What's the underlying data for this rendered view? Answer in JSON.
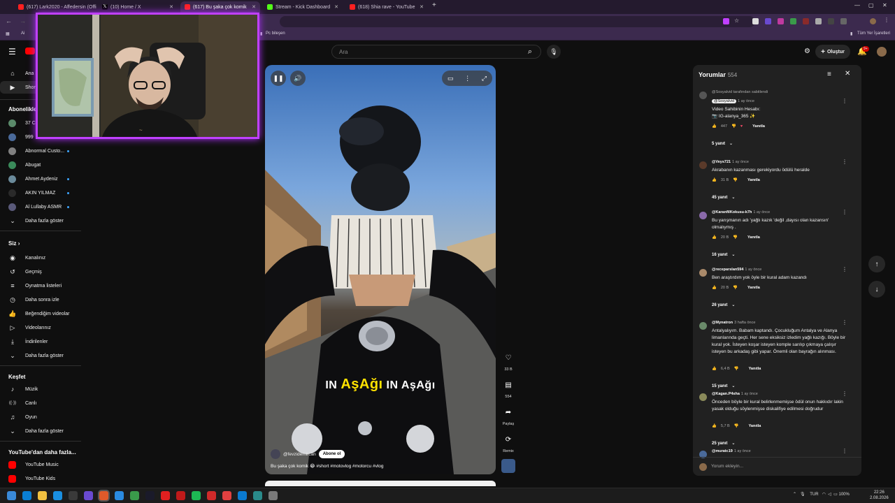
{
  "browser": {
    "tabs": [
      {
        "label": "(617) Lark2020 - Affedersin (Offi",
        "color": "#ff2020"
      },
      {
        "label": "(10) Home / X",
        "color": "#ffffff"
      },
      {
        "label": "(617) Bu şaka çok komik",
        "color": "#ff2020"
      },
      {
        "label": "Stream - Kick Dashboard",
        "color": "#53fc18"
      },
      {
        "label": "(618) Shia rave - YouTube",
        "color": "#ff2020"
      }
    ],
    "new_tab": "+",
    "bookmarks": {
      "pc": "Pc bileşen",
      "all": "Tüm Yer İşaretleri",
      "ai": "Ai"
    }
  },
  "header": {
    "logo_text": "YouTube",
    "search_placeholder": "Ara",
    "create_label": "Oluştur",
    "notif_badge": "9+"
  },
  "sidebar": {
    "main": [
      {
        "label": "Ana Sayfa",
        "icon": "home-icon"
      },
      {
        "label": "Shorts",
        "icon": "shorts-icon"
      }
    ],
    "subs_title": "Abonelikler",
    "subs": [
      {
        "label": "37 C",
        "color": "#5a8a6a",
        "dot": false
      },
      {
        "label": "999",
        "color": "#4a6a9a",
        "dot": false
      },
      {
        "label": "Abnormal Custo...",
        "color": "#808080",
        "dot": true
      },
      {
        "label": "Abugat",
        "color": "#3a8a5a",
        "dot": false
      },
      {
        "label": "Ahmet Aydeniz",
        "color": "#6a8a9a",
        "dot": true
      },
      {
        "label": "AKIN YILMAZ",
        "color": "#2a2a2a",
        "dot": true
      },
      {
        "label": "Al Lullaby ASMR",
        "color": "#5a5a7a",
        "dot": true
      }
    ],
    "show_more": "Daha fazla göster",
    "you_title": "Siz",
    "you": [
      {
        "label": "Kanalınız",
        "icon": "channel-icon"
      },
      {
        "label": "Geçmiş",
        "icon": "history-icon"
      },
      {
        "label": "Oynatma listeleri",
        "icon": "playlist-icon"
      },
      {
        "label": "Daha sonra izle",
        "icon": "clock-icon"
      },
      {
        "label": "Beğendiğim videolar",
        "icon": "like-icon"
      },
      {
        "label": "Videolarınız",
        "icon": "video-icon"
      },
      {
        "label": "İndirilenler",
        "icon": "download-icon"
      }
    ],
    "explore_title": "Keşfet",
    "explore": [
      {
        "label": "Müzik",
        "icon": "music-icon"
      },
      {
        "label": "Canlı",
        "icon": "live-icon"
      },
      {
        "label": "Oyun",
        "icon": "gaming-icon"
      }
    ],
    "more_yt_title": "YouTube'dan daha fazla...",
    "more_yt": [
      {
        "label": "YouTube Music",
        "color": "#ff0000"
      },
      {
        "label": "YouTube Kids",
        "color": "#ff0000"
      }
    ]
  },
  "video": {
    "caption_parts": [
      "IN ",
      "AşAğı",
      " IN AşAğı"
    ],
    "channel": "@fevzidemircan",
    "subscribe": "Abone ol",
    "description": "Bu şaka çok komik 😂 #short #motovlog #motorcu #vlog",
    "actions": {
      "likes": "33 B",
      "comments": "554",
      "share": "Paylaş",
      "remix": "Remix"
    }
  },
  "comments": {
    "title": "Yorumlar",
    "count": "554",
    "reply_label": "Yanıtla",
    "add_placeholder": "Yorum ekleyin...",
    "items": [
      {
        "pinned": "@Sosyalvid tarafından sabitlendi",
        "user": "@Sosyalvid",
        "time": "1 ay önce",
        "text": "Video Sahibinin Hesabı:\n📷 IG-alanya_365 ✨",
        "likes": "447",
        "replies": "5 yanıt",
        "color": "#555"
      },
      {
        "user": "@Veys721",
        "time": "1 ay önce",
        "text": "Akrabanın kazanması gerekiyordu ödülü heralde",
        "likes": "31 B",
        "replies": "45 yanıt",
        "color": "#5a3a2a"
      },
      {
        "user": "@KaranfilKokusu-k7h",
        "time": "1 ay önce",
        "text": "Bu yarışmanın adı 'yağlı kazık 'değil ,dayısı olan kazansın' olmalıymış .",
        "likes": "20 B",
        "replies": "16 yanıt",
        "color": "#8a6aaa"
      },
      {
        "user": "@receparslan594",
        "time": "1 ay önce",
        "text": "Ben araştırdım yok öyle bir kural adam kazandı",
        "likes": "20 B",
        "replies": "26 yanıt",
        "color": "#aa8a6a"
      },
      {
        "user": "@Mynatron",
        "time": "3 hafta önce",
        "text": "Antalyalıyım. Babam kaptandı. Çocukluğum Antalya ve Alanya limanlarında geçti. Her sene eksiksiz izledim yağlı kazığı. Böyle bir kural yok. İsteyen koşar isteyen komple sarılıp çıkmaya çalışır isteyen bu arkadaş gibi yapar. Önemli olan bayrağın alınması.",
        "likes": "6,4 B",
        "replies": "15 yanıt",
        "color": "#6a8a6a"
      },
      {
        "user": "@Kagan.P4sha",
        "time": "1 ay önce",
        "text": "Önceden böyle bir kural belirlenmemişse ödül onun hakkıdır lakin yasak olduğu söylenmişse diskalifiye edilmesi doğrudur",
        "likes": "5,7 B",
        "replies": "25 yanıt",
        "color": "#8a8a5a"
      },
      {
        "user": "@muratc19",
        "time": "1 ay önce",
        "text": "",
        "likes": "",
        "replies": "",
        "color": "#4a6a9a"
      }
    ]
  },
  "taskbar": {
    "lang": "TUR",
    "battery": "100%",
    "time": "22:26",
    "date": "2.08.2026",
    "apps": [
      "#0a7fd4",
      "#f0c040",
      "#1a8fe0",
      "#3a3a3a",
      "#6a4ad0",
      "#e05a2a",
      "#2a8ae0",
      "#3a9a4a",
      "#1a1a2a",
      "#e02020",
      "#c01a1a",
      "#1db954",
      "#d02a2a",
      "#e04040",
      "#0a7ad0",
      "#2a8a8a",
      "#7a7a7a"
    ]
  },
  "colors": {
    "accent": "#3ea6ff",
    "webcam_border": "#c040ff",
    "yt_red": "#ff0000"
  }
}
